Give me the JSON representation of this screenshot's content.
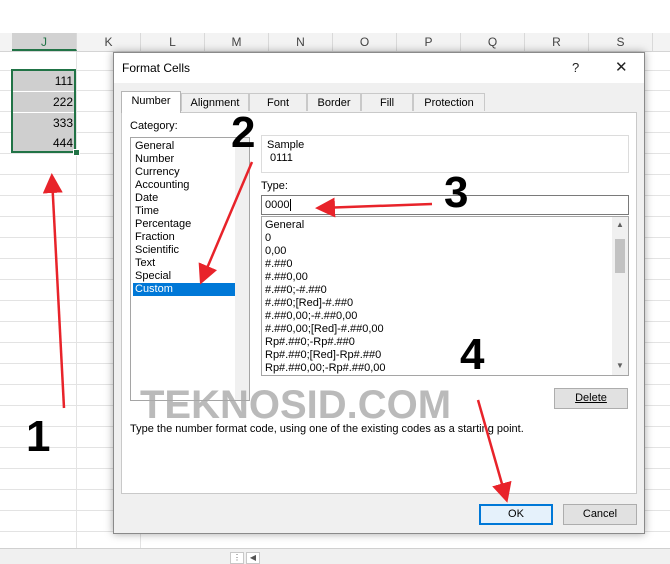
{
  "sheet": {
    "columns": [
      "J",
      "K",
      "L",
      "M",
      "N",
      "O",
      "P",
      "Q",
      "R",
      "S"
    ],
    "selected_column": "J",
    "cells": [
      "111",
      "222",
      "333",
      "444"
    ]
  },
  "dialog": {
    "title": "Format Cells",
    "help_label": "?",
    "close_label": "✕",
    "tabs": [
      "Number",
      "Alignment",
      "Font",
      "Border",
      "Fill",
      "Protection"
    ],
    "active_tab": "Number",
    "category_label": "Category:",
    "categories": [
      "General",
      "Number",
      "Currency",
      "Accounting",
      "Date",
      "Time",
      "Percentage",
      "Fraction",
      "Scientific",
      "Text",
      "Special",
      "Custom"
    ],
    "selected_category": "Custom",
    "sample_label": "Sample",
    "sample_value": "0111",
    "type_label": "Type:",
    "type_value": "0000",
    "formats": [
      "General",
      "0",
      "0,00",
      "#.##0",
      "#.##0,00",
      "#.##0;-#.##0",
      "#.##0;[Red]-#.##0",
      "#.##0,00;-#.##0,00",
      "#.##0,00;[Red]-#.##0,00",
      "Rp#.##0;-Rp#.##0",
      "Rp#.##0;[Red]-Rp#.##0",
      "Rp#.##0,00;-Rp#.##0,00"
    ],
    "delete_label": "Delete",
    "description": "Type the number format code, using one of the existing codes as a starting point.",
    "ok_label": "OK",
    "cancel_label": "Cancel"
  },
  "watermark": "TEKNOSID.COM",
  "annotations": [
    "1",
    "2",
    "3",
    "4"
  ],
  "colors": {
    "selection": "#0078d7",
    "excel_green": "#217346",
    "arrow": "#e8232a"
  }
}
